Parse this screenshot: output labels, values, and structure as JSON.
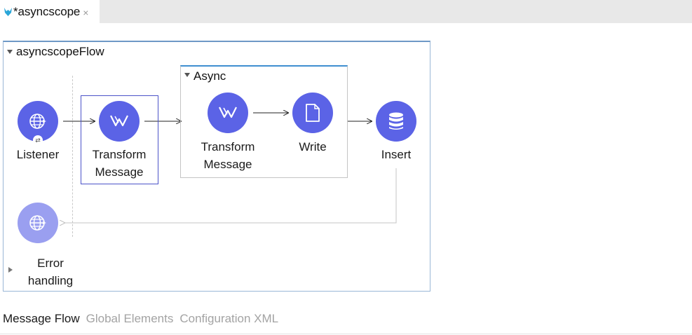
{
  "editor_tab": {
    "title": "*asyncscope",
    "close_glyph": "×",
    "icon": "mule-icon"
  },
  "flow": {
    "name": "asyncscopeFlow",
    "nodes": {
      "listener": {
        "label": "Listener",
        "icon": "globe-icon"
      },
      "transform1": {
        "label_line1": "Transform",
        "label_line2": "Message",
        "icon": "dataweave-icon"
      },
      "transform2": {
        "label_line1": "Transform",
        "label_line2": "Message",
        "icon": "dataweave-icon"
      },
      "write": {
        "label": "Write",
        "icon": "file-icon"
      },
      "insert": {
        "label": "Insert",
        "icon": "database-icon"
      }
    },
    "async_scope": {
      "title": "Async"
    },
    "error_handling": {
      "label_line1": "Error",
      "label_line2": "handling",
      "icon": "globe-icon"
    }
  },
  "bottom_tabs": [
    {
      "label": "Message Flow",
      "active": true
    },
    {
      "label": "Global Elements",
      "active": false
    },
    {
      "label": "Configuration XML",
      "active": false
    }
  ],
  "colors": {
    "node_accent": "#5b63e6",
    "node_muted": "#9a9ff0",
    "selection_border": "#4b53c9",
    "async_accent": "#3f8fd0"
  }
}
